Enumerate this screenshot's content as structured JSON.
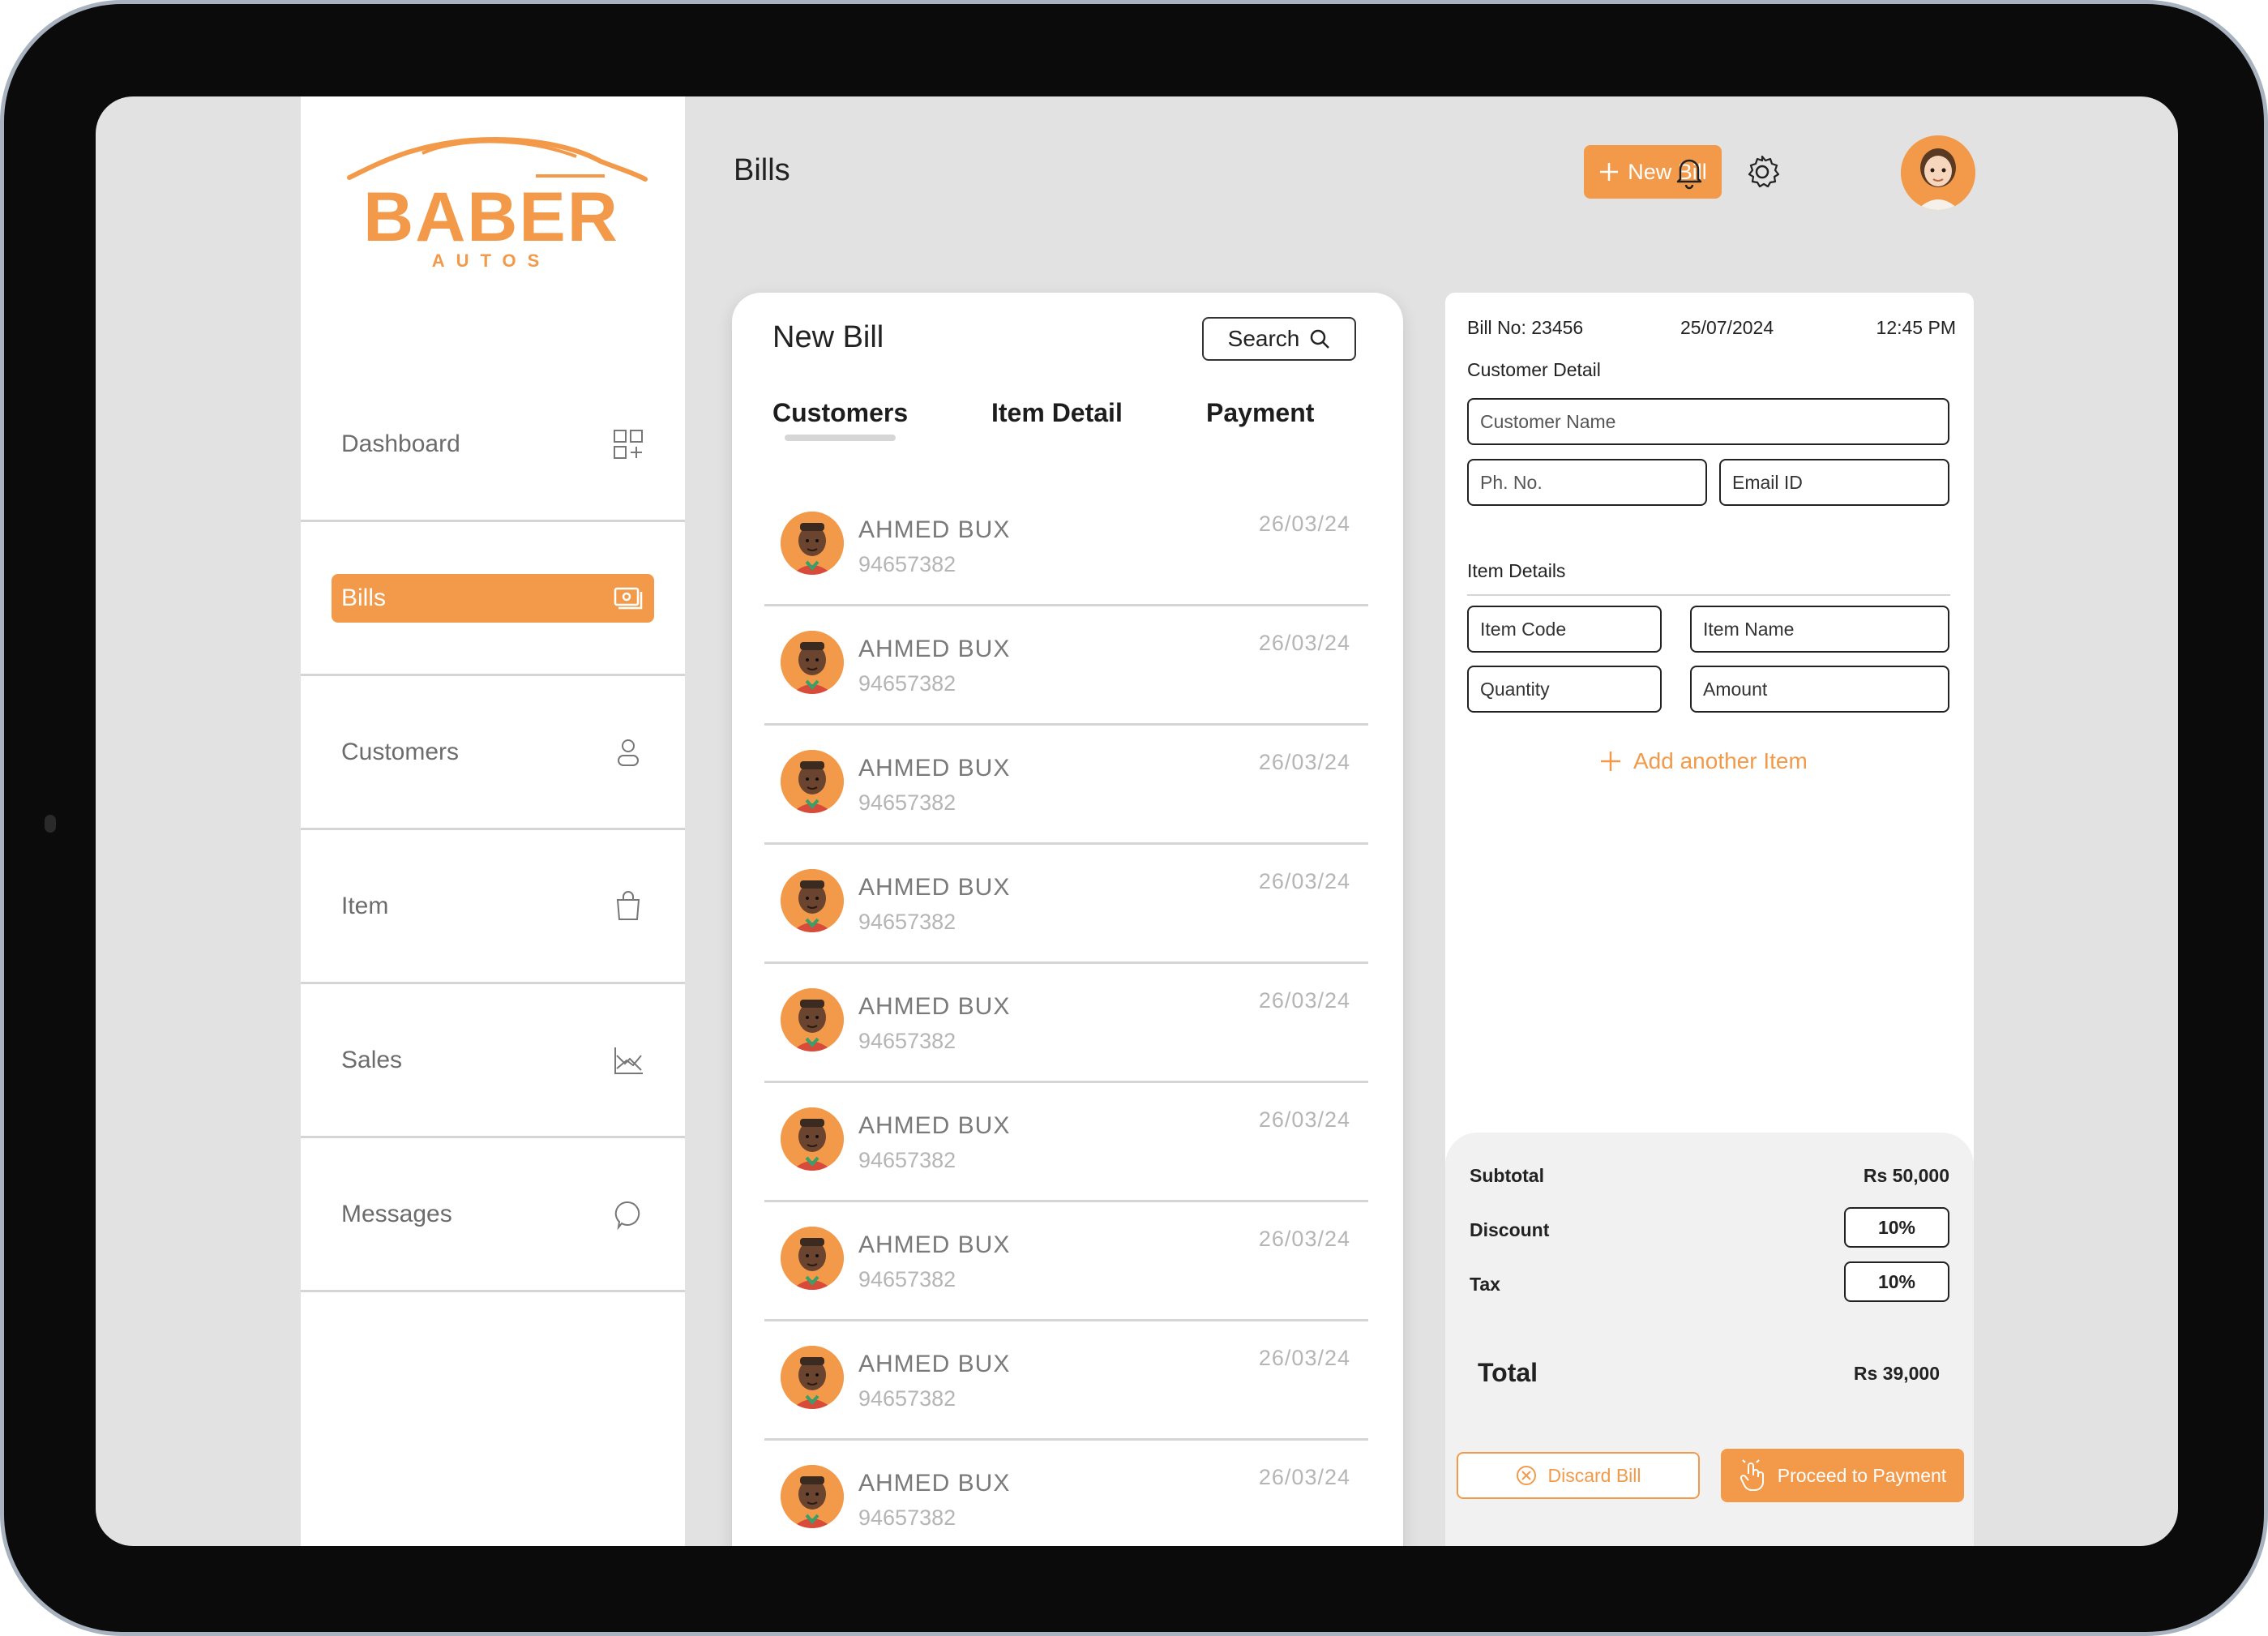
{
  "brand": {
    "name": "BABER",
    "sub": "AUTOS",
    "accent": "#f29a4a"
  },
  "sidebar": {
    "items": [
      {
        "label": "Dashboard",
        "icon": "dashboard-grid-icon"
      },
      {
        "label": "Bills",
        "icon": "bill-icon",
        "active": true
      },
      {
        "label": "Customers",
        "icon": "user-icon"
      },
      {
        "label": "Item",
        "icon": "shopping-bag-icon"
      },
      {
        "label": "Sales",
        "icon": "chart-icon"
      },
      {
        "label": "Messages",
        "icon": "message-icon"
      }
    ]
  },
  "header": {
    "title": "Bills",
    "new_bill_label": "New Bill",
    "notification_icon": "bell-icon",
    "settings_icon": "gear-icon"
  },
  "new_bill_panel": {
    "title": "New Bill",
    "search_label": "Search",
    "tabs": [
      "Customers",
      "Item Detail",
      "Payment"
    ],
    "active_tab": "Customers",
    "customers": [
      {
        "name": "AHMED BUX",
        "phone": "94657382",
        "date": "26/03/24"
      },
      {
        "name": "AHMED BUX",
        "phone": "94657382",
        "date": "26/03/24"
      },
      {
        "name": "AHMED BUX",
        "phone": "94657382",
        "date": "26/03/24"
      },
      {
        "name": "AHMED BUX",
        "phone": "94657382",
        "date": "26/03/24"
      },
      {
        "name": "AHMED BUX",
        "phone": "94657382",
        "date": "26/03/24"
      },
      {
        "name": "AHMED BUX",
        "phone": "94657382",
        "date": "26/03/24"
      },
      {
        "name": "AHMED BUX",
        "phone": "94657382",
        "date": "26/03/24"
      },
      {
        "name": "AHMED BUX",
        "phone": "94657382",
        "date": "26/03/24"
      },
      {
        "name": "AHMED BUX",
        "phone": "94657382",
        "date": "26/03/24"
      }
    ]
  },
  "bill": {
    "bill_no": "Bill No: 23456",
    "date": "25/07/2024",
    "time": "12:45 PM",
    "customer_section": "Customer Detail",
    "customer_name_placeholder": "Customer Name",
    "phone_placeholder": "Ph. No.",
    "email_placeholder": "Email ID",
    "item_section": "Item Details",
    "item_code_placeholder": "Item Code",
    "item_name_placeholder": "Item Name",
    "quantity_placeholder": "Quantity",
    "amount_placeholder": "Amount",
    "add_item_label": "Add another Item",
    "subtotal_label": "Subtotal",
    "subtotal_value": "Rs 50,000",
    "discount_label": "Discount",
    "discount_value": "10%",
    "tax_label": "Tax",
    "tax_value": "10%",
    "total_label": "Total",
    "total_value": "Rs 39,000",
    "discard_label": "Discard Bill",
    "proceed_label": "Proceed to Payment"
  }
}
